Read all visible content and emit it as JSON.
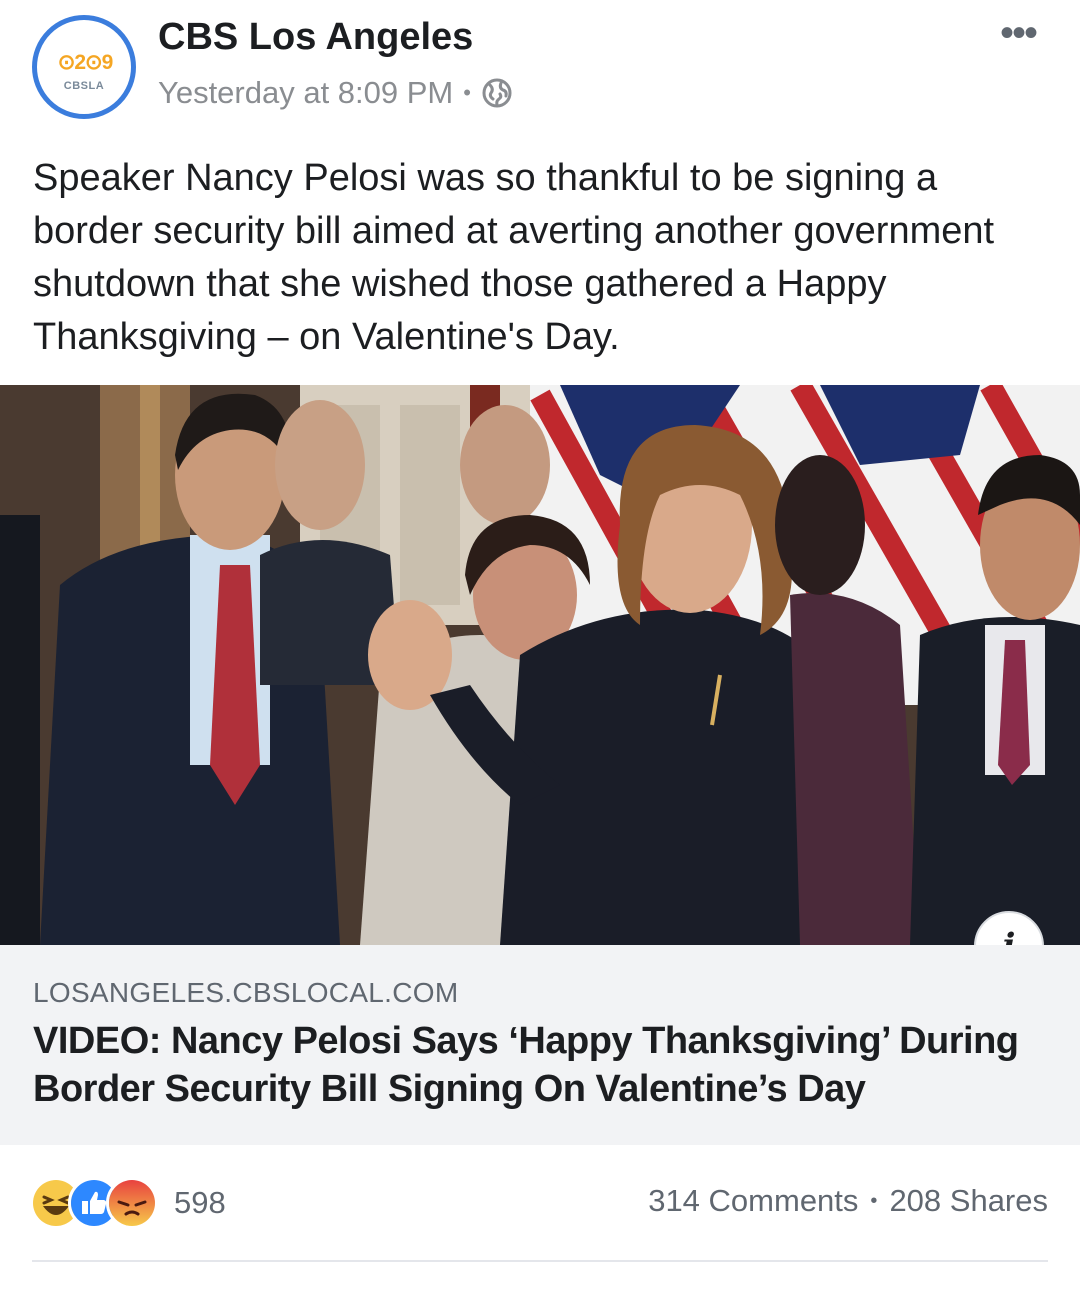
{
  "header": {
    "page_name": "CBS Los Angeles",
    "timestamp": "Yesterday at 8:09 PM",
    "separator": "•",
    "more_label": "•••",
    "avatar": {
      "logo_text": "⊙2⊙9",
      "sub_text": "CBSLA"
    }
  },
  "post": {
    "text": "Speaker Nancy Pelosi was so thankful to be signing a border security bill aimed at averting another government shutdown that she wished those gathered a Happy Thanksgiving – on Valentine's Day."
  },
  "link": {
    "domain": "LOSANGELES.CBSLOCAL.COM",
    "headline": "VIDEO: Nancy Pelosi Says ‘Happy Thanksgiving’ During Border Security Bill Signing On Valentine’s Day",
    "info_icon": "i"
  },
  "stats": {
    "reaction_icons": [
      "haha-icon",
      "like-icon",
      "angry-icon"
    ],
    "reaction_count": "598",
    "comments": "314 Comments",
    "separator": "•",
    "shares": "208 Shares"
  },
  "colors": {
    "accent": "#3b7ddd",
    "text": "#1c1e21",
    "muted": "#606770",
    "link_bg": "#f2f3f5"
  }
}
